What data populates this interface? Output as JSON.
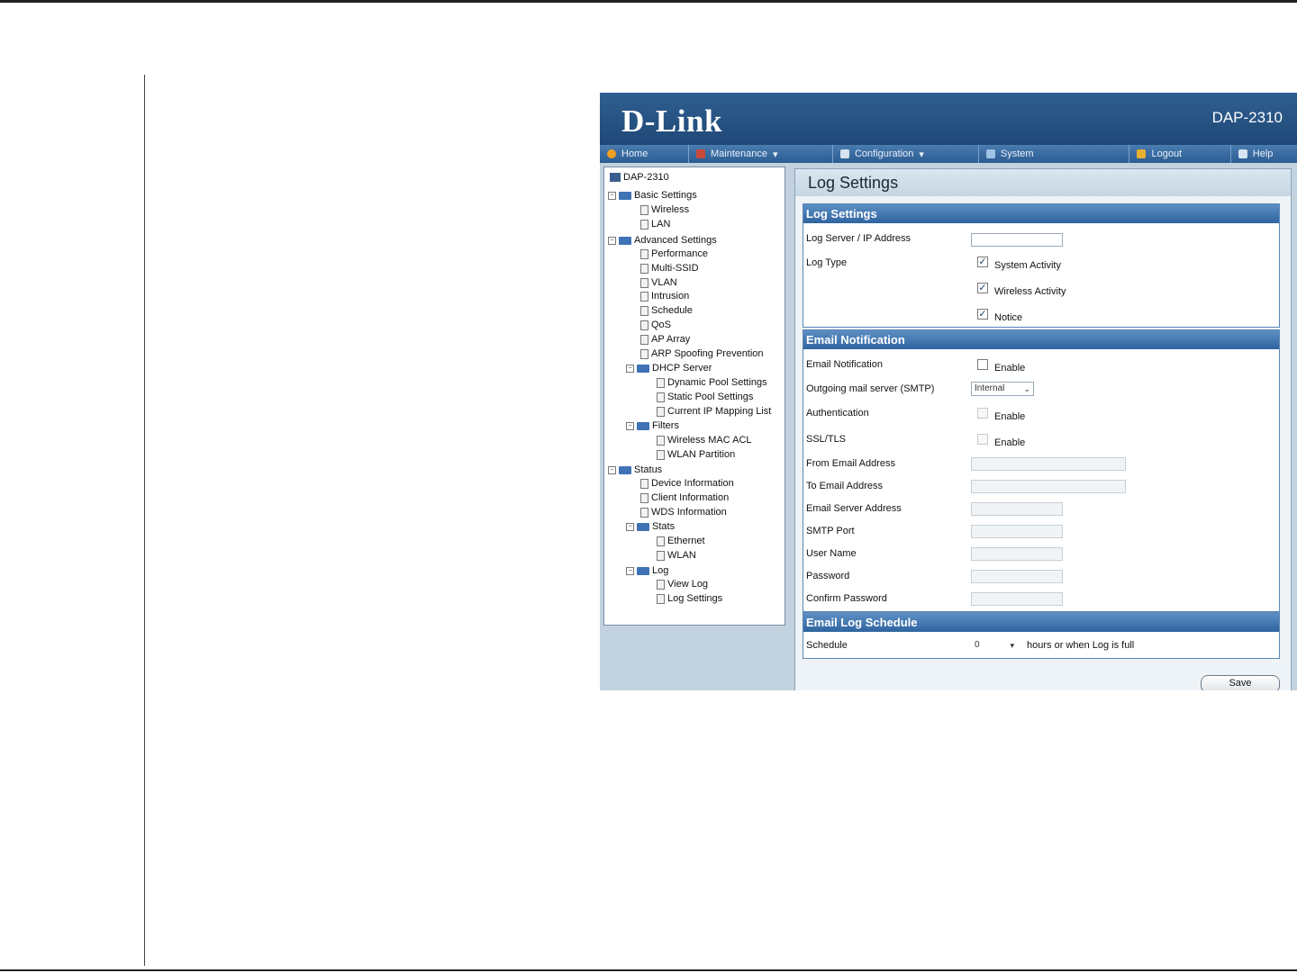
{
  "app": {
    "brand": "D-Link",
    "model": "DAP-2310"
  },
  "menu": [
    {
      "label": "Home",
      "icon": "home-icon"
    },
    {
      "label": "Maintenance",
      "icon": "tools-icon",
      "dropdown": true
    },
    {
      "label": "Configuration",
      "icon": "config-icon",
      "dropdown": true
    },
    {
      "label": "System",
      "icon": "system-icon"
    },
    {
      "label": "Logout",
      "icon": "logout-icon"
    },
    {
      "label": "Help",
      "icon": "help-icon"
    }
  ],
  "tree": {
    "root": "DAP-2310",
    "basic_settings": "Basic Settings",
    "wireless": "Wireless",
    "lan": "LAN",
    "advanced_settings": "Advanced Settings",
    "performance": "Performance",
    "multi_ssid": "Multi-SSID",
    "vlan": "VLAN",
    "intrusion": "Intrusion",
    "schedule": "Schedule",
    "qos": "QoS",
    "ap_array": "AP Array",
    "arp": "ARP Spoofing Prevention",
    "dhcp_server": "DHCP Server",
    "dynamic_pool": "Dynamic Pool Settings",
    "static_pool": "Static Pool Settings",
    "current_ip": "Current IP Mapping List",
    "filters": "Filters",
    "wireless_mac_acl": "Wireless MAC ACL",
    "wlan_partition": "WLAN Partition",
    "status": "Status",
    "device_information": "Device Information",
    "client_information": "Client Information",
    "wds_information": "WDS Information",
    "stats": "Stats",
    "ethernet": "Ethernet",
    "wlan": "WLAN",
    "log": "Log",
    "view_log": "View Log",
    "log_settings": "Log Settings"
  },
  "page": {
    "title": "Log Settings",
    "log_section": {
      "title": "Log Settings",
      "server_label": "Log Server / IP Address",
      "server_value": "",
      "type_label": "Log Type",
      "system_activity": "System Activity",
      "wireless_activity": "Wireless Activity",
      "notice": "Notice"
    },
    "email_section": {
      "title": "Email Notification",
      "notification_label": "Email Notification",
      "enable": "Enable",
      "smtp_label": "Outgoing mail server (SMTP)",
      "smtp_value": "Internal",
      "auth_label": "Authentication",
      "ssl_label": "SSL/TLS",
      "from_label": "From Email Address",
      "to_label": "To Email Address",
      "server_label": "Email Server Address",
      "port_label": "SMTP Port",
      "user_label": "User Name",
      "password_label": "Password",
      "confirm_label": "Confirm Password"
    },
    "schedule_section": {
      "title": "Email Log Schedule",
      "label": "Schedule",
      "value": "0",
      "suffix": "hours or when Log is full"
    },
    "save_label": "Save"
  }
}
